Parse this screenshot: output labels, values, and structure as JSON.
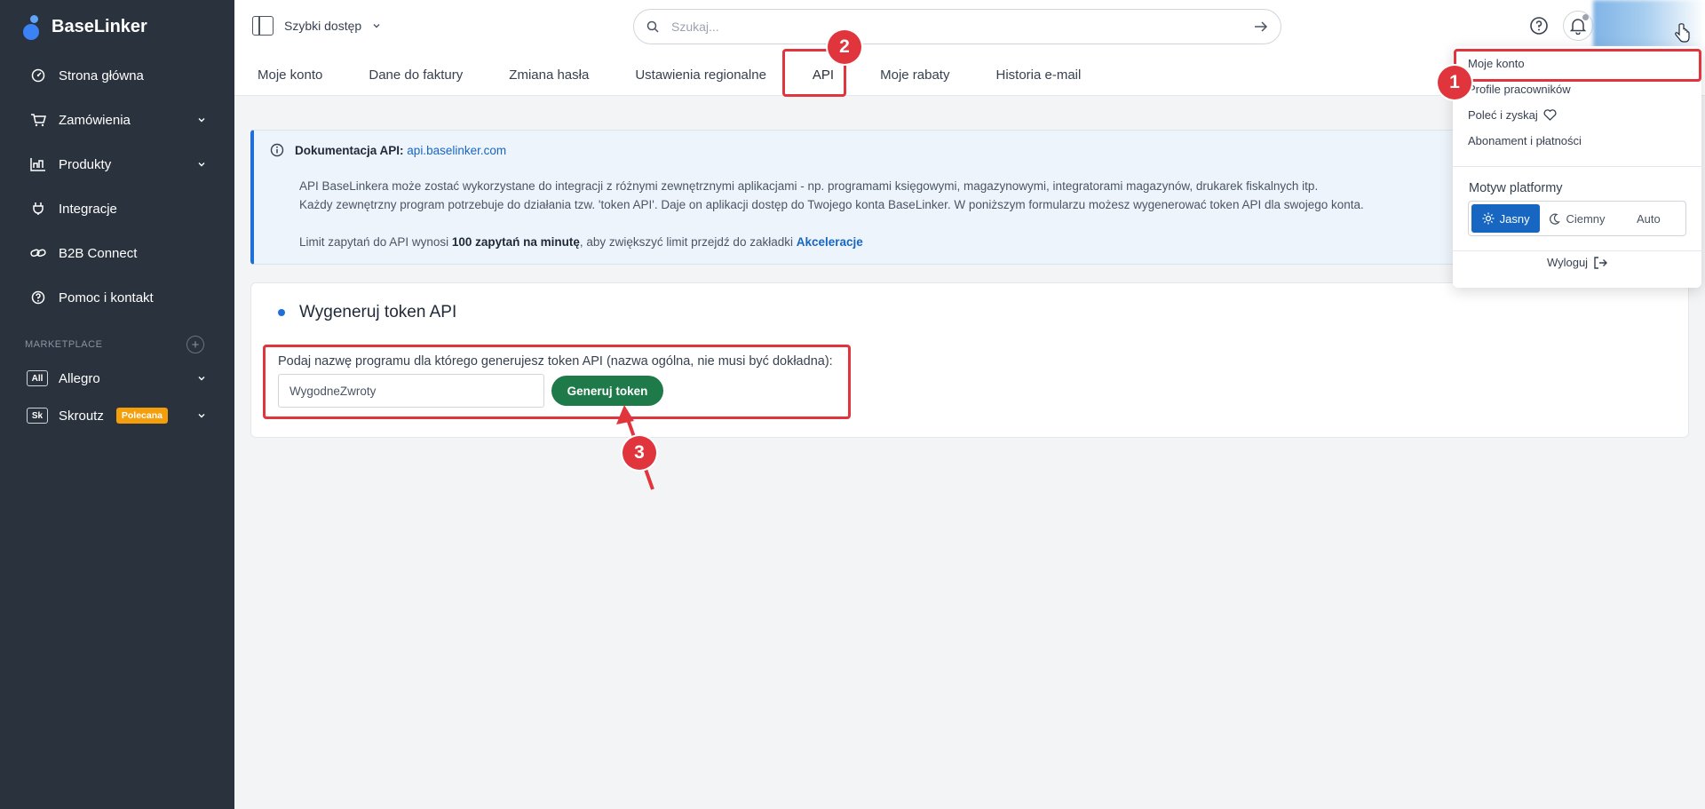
{
  "brand": {
    "name": "BaseLinker"
  },
  "sidebar": {
    "items": [
      {
        "label": "Strona główna",
        "icon": "dashboard-icon",
        "has_chevron": false
      },
      {
        "label": "Zamówienia",
        "icon": "cart-icon",
        "has_chevron": true
      },
      {
        "label": "Produkty",
        "icon": "products-icon",
        "has_chevron": true
      },
      {
        "label": "Integracje",
        "icon": "plug-icon",
        "has_chevron": false
      },
      {
        "label": "B2B Connect",
        "icon": "link-icon",
        "has_chevron": false
      },
      {
        "label": "Pomoc i kontakt",
        "icon": "help-icon",
        "has_chevron": false
      }
    ],
    "section_label": "MARKETPLACE",
    "marketplace": [
      {
        "abbr": "All",
        "label": "Allegro",
        "badge": ""
      },
      {
        "abbr": "Sk",
        "label": "Skroutz",
        "badge": "Polecana"
      }
    ]
  },
  "header": {
    "quick_access": "Szybki dostęp",
    "search_placeholder": "Szukaj..."
  },
  "tabs": [
    {
      "label": "Moje konto"
    },
    {
      "label": "Dane do faktury"
    },
    {
      "label": "Zmiana hasła"
    },
    {
      "label": "Ustawienia regionalne"
    },
    {
      "label": "API"
    },
    {
      "label": "Moje rabaty"
    },
    {
      "label": "Historia e-mail"
    }
  ],
  "info": {
    "doc_label": "Dokumentacja API:",
    "doc_link": "api.baselinker.com",
    "para1": "API BaseLinkera może zostać wykorzystane do integracji z różnymi zewnętrznymi aplikacjami - np. programami księgowymi, magazynowymi, integratorami magazynów, drukarek fiskalnych itp.",
    "para2": "Każdy zewnętrzny program potrzebuje do działania tzw. 'token API'. Daje on aplikacji dostęp do Twojego konta BaseLinker. W poniższym formularzu możesz wygenerować token API dla swojego konta.",
    "limit_prefix": "Limit zapytań do API wynosi ",
    "limit_bold": "100 zapytań na minutę",
    "limit_mid": ", aby zwiększyć limit przejdź do zakładki ",
    "limit_link": "Akceleracje"
  },
  "card": {
    "title": "Wygeneruj token API",
    "form_label": "Podaj nazwę programu dla którego generujesz token API (nazwa ogólna, nie musi być dokładna):",
    "input_value": "WygodneZwroty",
    "button": "Generuj token"
  },
  "dropdown": {
    "items": [
      "Moje konto",
      "Profile pracowników",
      "Poleć i zyskaj",
      "Abonament i płatności"
    ],
    "theme_label": "Motyw platformy",
    "themes": [
      "Jasny",
      "Ciemny",
      "Auto"
    ],
    "logout": "Wyloguj"
  },
  "annotations": {
    "n1": "1",
    "n2": "2",
    "n3": "3"
  },
  "colors": {
    "sidebar": "#2a323d",
    "accent": "#1766c2",
    "button": "#1f7a4a",
    "annotation": "#e0353d",
    "badge": "#f59e0b"
  }
}
